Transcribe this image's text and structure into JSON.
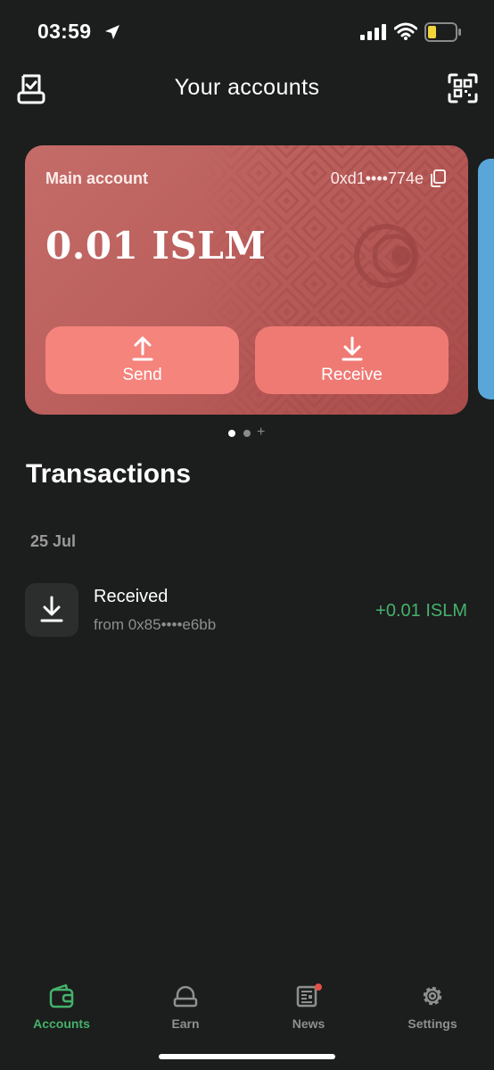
{
  "status_bar": {
    "time": "03:59",
    "icons": [
      "location-arrow-icon",
      "cellular-signal-icon",
      "wifi-icon",
      "battery-low-icon"
    ]
  },
  "header": {
    "title": "Your accounts",
    "left_icon": "receipt-icon",
    "right_icon": "qr-scan-icon"
  },
  "account_card": {
    "label": "Main account",
    "address": "0xd1••••774e",
    "balance": "0.01 ISLM",
    "send_label": "Send",
    "receive_label": "Receive",
    "color": "#c0625f"
  },
  "pager": {
    "add_symbol": "+"
  },
  "transactions": {
    "title": "Transactions",
    "groups": [
      {
        "date": "25 Jul",
        "items": [
          {
            "title": "Received",
            "subtitle": "from 0x85••••e6bb",
            "amount": "+0.01 ISLM",
            "icon": "download-icon"
          }
        ]
      }
    ]
  },
  "bottom_nav": {
    "items": [
      {
        "label": "Accounts",
        "icon": "wallet-icon",
        "active": true
      },
      {
        "label": "Earn",
        "icon": "bank-icon",
        "active": false
      },
      {
        "label": "News",
        "icon": "newspaper-icon",
        "active": false
      },
      {
        "label": "Settings",
        "icon": "gear-icon",
        "active": false
      }
    ]
  },
  "colors": {
    "background": "#1c1d1d",
    "accent": "#45b26b",
    "card": "#c0625f",
    "card_button": "#f2807a"
  }
}
